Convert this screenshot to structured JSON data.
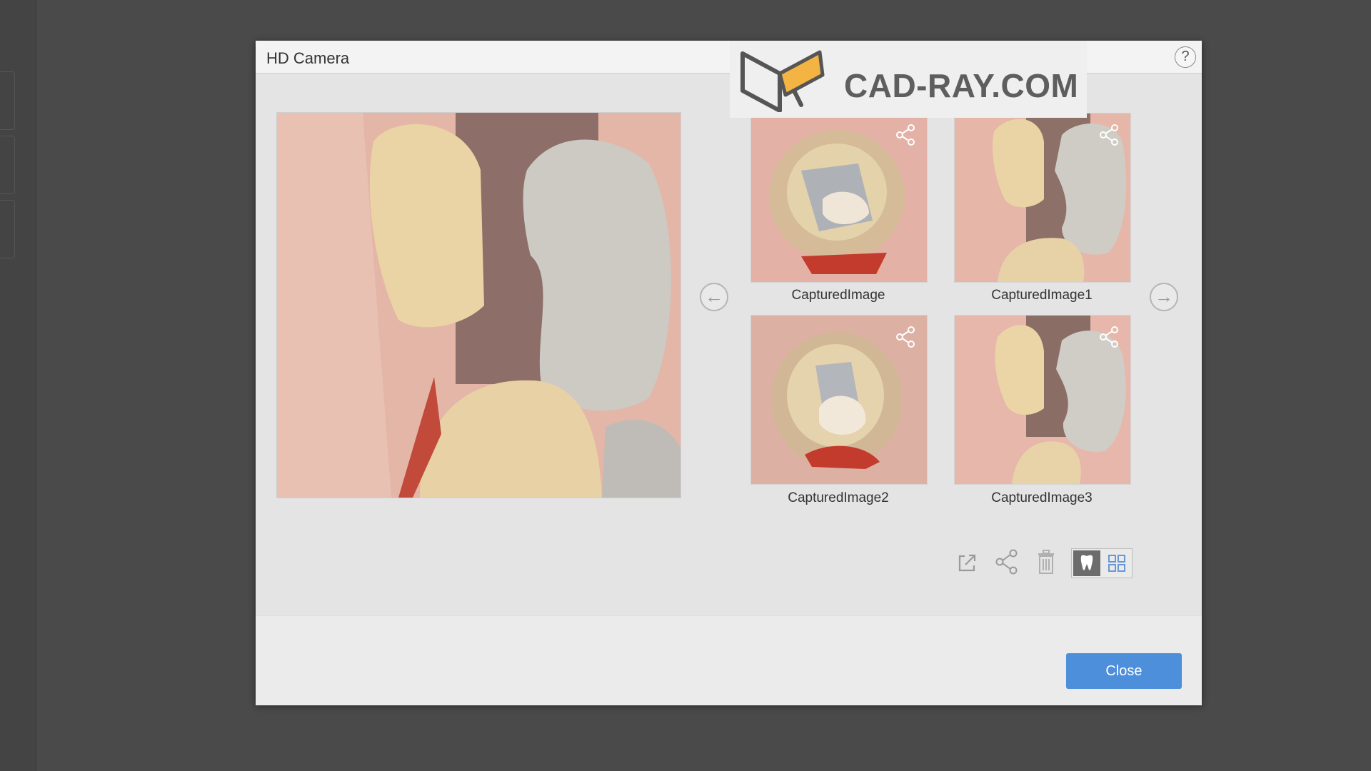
{
  "dialog": {
    "title": "HD Camera",
    "help_label": "?"
  },
  "watermark": {
    "text": "CAD-RAY.COM"
  },
  "navigation": {
    "prev_glyph": "←",
    "next_glyph": "→"
  },
  "thumbnails": [
    {
      "label": "CapturedImage"
    },
    {
      "label": "CapturedImage1"
    },
    {
      "label": "CapturedImage2"
    },
    {
      "label": "CapturedImage3"
    }
  ],
  "toolbar": {
    "icons": [
      "export-icon",
      "share-icon",
      "trash-icon",
      "tooth-view-icon",
      "grid-view-icon"
    ]
  },
  "footer": {
    "close_label": "Close"
  },
  "colors": {
    "accent": "#4e8fdb",
    "background": "#4a4a4a",
    "dialog": "#e4e4e4"
  }
}
